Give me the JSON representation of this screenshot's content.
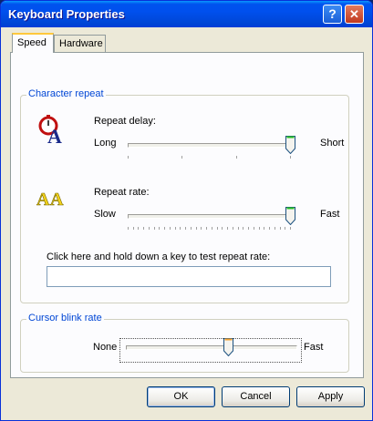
{
  "window": {
    "title": "Keyboard Properties",
    "help_glyph": "?",
    "close_glyph": "✕"
  },
  "tabs": [
    {
      "label": "Speed"
    },
    {
      "label": "Hardware"
    }
  ],
  "character_repeat": {
    "group_label": "Character repeat",
    "repeat_delay": {
      "label": "Repeat delay:",
      "left": "Long",
      "right": "Short",
      "value": 1.0,
      "ticks": 4
    },
    "repeat_rate": {
      "label": "Repeat rate:",
      "left": "Slow",
      "right": "Fast",
      "value": 1.0,
      "ticks": 32
    },
    "test_prompt": "Click here and hold down a key to test repeat rate:",
    "test_value": ""
  },
  "cursor_blink": {
    "group_label": "Cursor blink rate",
    "left": "None",
    "right": "Fast",
    "value": 0.6
  },
  "buttons": {
    "ok": "OK",
    "cancel": "Cancel",
    "apply": "Apply"
  },
  "colors": {
    "accent": "#0046d5",
    "title_bar": "#0050ee",
    "tab_highlight": "#ffc83c"
  }
}
